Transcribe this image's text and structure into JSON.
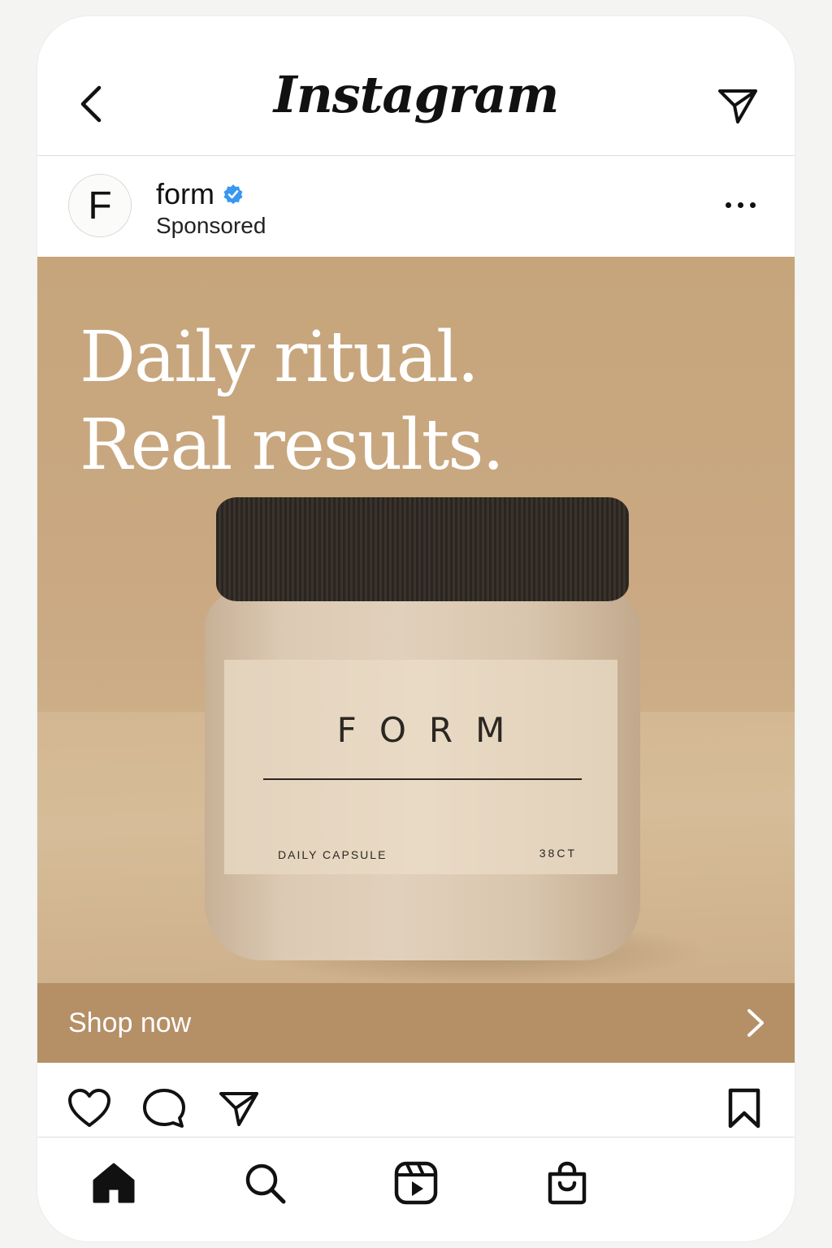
{
  "app": {
    "title": "Instagram"
  },
  "header": {
    "back_icon": "chevron-left-icon",
    "dm_icon": "paper-plane-icon"
  },
  "post": {
    "account": {
      "avatar_letter": "F",
      "name": "form",
      "verified": true,
      "verified_color": "#3897f0",
      "sponsored_label": "Sponsored"
    },
    "more_icon": "ellipsis-icon",
    "ad": {
      "headline_line1": "Daily ritual.",
      "headline_line2": "Real results.",
      "background_color": "#c9a97f",
      "jar": {
        "brand": "FORM",
        "product": "DAILY CAPSULE",
        "count": "38CT"
      }
    },
    "cta": {
      "label": "Shop now",
      "color": "#b58f66"
    },
    "actions": {
      "like_icon": "heart-icon",
      "comment_icon": "comment-icon",
      "share_icon": "paper-plane-icon",
      "save_icon": "bookmark-icon"
    }
  },
  "bottom_nav": [
    "home-icon",
    "search-icon",
    "reels-icon",
    "shop-icon"
  ]
}
